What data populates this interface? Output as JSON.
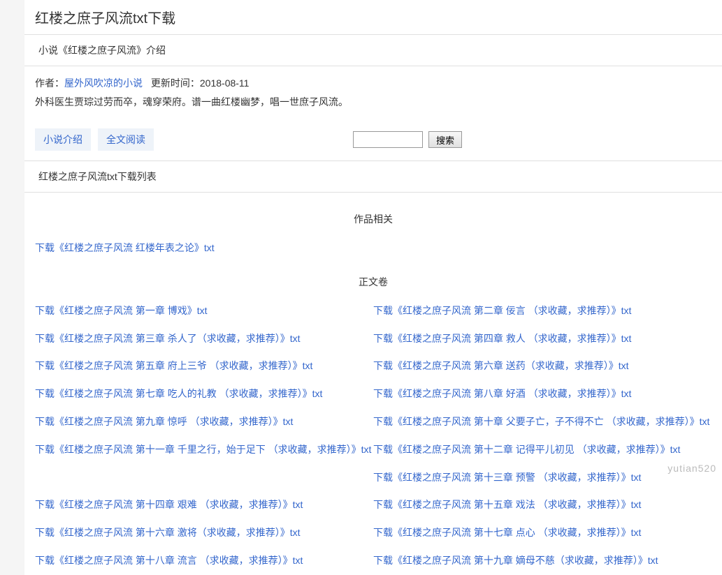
{
  "page_title": "红楼之庶子风流txt下载",
  "intro_header": "小说《红楼之庶子风流》介绍",
  "author_label": "作者：",
  "author_name": "屋外风吹凉的小说",
  "update_time": "更新时间：2018-08-11",
  "description": "外科医生贾琮过劳而卒，魂穿荣府。谱一曲红楼幽梦，唱一世庶子风流。",
  "nav": {
    "intro": "小说介绍",
    "fulltext": "全文阅读"
  },
  "search_btn": "搜索",
  "list_header": "红楼之庶子风流txt下载列表",
  "volumes": [
    {
      "name": "作品相关",
      "chapters": [
        {
          "left": "下载《红楼之庶子风流 红楼年表之论》txt",
          "right": ""
        }
      ]
    },
    {
      "name": "正文卷",
      "chapters": [
        {
          "left": "下载《红楼之庶子风流 第一章 博戏》txt",
          "right": "下载《红楼之庶子风流 第二章 佞言 （求收藏，求推荐）》txt"
        },
        {
          "left": "下载《红楼之庶子风流 第三章 杀人了（求收藏，求推荐）》txt",
          "right": "下载《红楼之庶子风流 第四章 救人 （求收藏，求推荐）》txt"
        },
        {
          "left": "下载《红楼之庶子风流 第五章 府上三爷 （求收藏，求推荐）》txt",
          "right": "下载《红楼之庶子风流 第六章 送药（求收藏，求推荐）》txt"
        },
        {
          "left": "下载《红楼之庶子风流 第七章 吃人的礼教 （求收藏，求推荐）》txt",
          "right": "下载《红楼之庶子风流 第八章 好酒 （求收藏，求推荐）》txt"
        },
        {
          "left": "下载《红楼之庶子风流 第九章 惊呼 （求收藏，求推荐）》txt",
          "right": "下载《红楼之庶子风流 第十章 父要子亡，子不得不亡 （求收藏，求推荐）》txt"
        },
        {
          "left": "下载《红楼之庶子风流 第十一章 千里之行，始于足下 （求收藏，求推荐）》txt",
          "right": "下载《红楼之庶子风流 第十二章 记得平儿初见 （求收藏，求推荐）》txt"
        },
        {
          "left": "",
          "right": "下载《红楼之庶子风流 第十三章 预警 （求收藏，求推荐）》txt"
        },
        {
          "left": "下载《红楼之庶子风流 第十四章 艰难 （求收藏，求推荐）》txt",
          "right": "下载《红楼之庶子风流 第十五章 戏法 （求收藏，求推荐）》txt"
        },
        {
          "left": "下载《红楼之庶子风流 第十六章 激将（求收藏，求推荐）》txt",
          "right": "下载《红楼之庶子风流 第十七章 点心 （求收藏，求推荐）》txt"
        },
        {
          "left": "下载《红楼之庶子风流 第十八章 流言 （求收藏，求推荐）》txt",
          "right": "下载《红楼之庶子风流 第十九章 嫡母不慈（求收藏，求推荐）》txt"
        }
      ]
    }
  ],
  "watermark": "yutian520"
}
